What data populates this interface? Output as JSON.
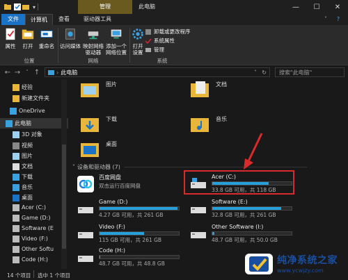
{
  "titlebar": {
    "context_tab": "管理",
    "window_title": "此电脑",
    "controls": [
      "minimize-icon",
      "maximize-icon",
      "close-icon"
    ]
  },
  "tabs": [
    "文件",
    "计算机",
    "查看",
    "驱动器工具"
  ],
  "ribbon": {
    "location": {
      "label": "位置",
      "buttons": [
        "属性",
        "打开",
        "重命名"
      ]
    },
    "network": {
      "label": "网络",
      "buttons": [
        "访问媒体",
        "映射网络\n驱动器",
        "添加一个\n网络位置"
      ]
    },
    "system": {
      "label": "系统",
      "big_button": "打开\n设置",
      "small": [
        "卸载或更改程序",
        "系统属性",
        "管理"
      ]
    }
  },
  "address": {
    "path": "此电脑",
    "search_placeholder": "搜索\"此电脑\""
  },
  "nav": {
    "items": [
      {
        "label": "经验",
        "icon": "folder-icon"
      },
      {
        "label": "新建文件夹",
        "icon": "folder-icon"
      },
      {
        "label": "OneDrive",
        "icon": "cloud-icon"
      },
      {
        "label": "此电脑",
        "icon": "computer-icon"
      },
      {
        "label": "3D 对象",
        "icon": "cube-icon"
      },
      {
        "label": "视频",
        "icon": "video-icon"
      },
      {
        "label": "图片",
        "icon": "picture-icon"
      },
      {
        "label": "文档",
        "icon": "document-icon"
      },
      {
        "label": "下载",
        "icon": "download-icon"
      },
      {
        "label": "音乐",
        "icon": "music-icon"
      },
      {
        "label": "桌面",
        "icon": "desktop-icon"
      },
      {
        "label": "Acer (C:)",
        "icon": "drive-icon"
      },
      {
        "label": "Game (D:)",
        "icon": "drive-icon"
      },
      {
        "label": "Software (E",
        "icon": "drive-icon"
      },
      {
        "label": "Video (F:)",
        "icon": "drive-icon"
      },
      {
        "label": "Other Softu",
        "icon": "drive-icon"
      },
      {
        "label": "Code (H:)",
        "icon": "drive-icon"
      }
    ]
  },
  "folders": [
    {
      "name": "图片",
      "icon": "pictures-folder-icon"
    },
    {
      "name": "文档",
      "icon": "documents-folder-icon"
    },
    {
      "name": "下载",
      "icon": "downloads-folder-icon"
    },
    {
      "name": "音乐",
      "icon": "music-folder-icon"
    },
    {
      "name": "桌面",
      "icon": "desktop-folder-icon"
    }
  ],
  "devices_header": "设备和驱动器 (7)",
  "baidu": {
    "name": "百度网盘",
    "sub": "双击运行百度网盘"
  },
  "drives": [
    {
      "name": "Acer (C:)",
      "sub": "33.8 GB 可用，共 118 GB",
      "used": 0.71
    },
    {
      "name": "Game (D:)",
      "sub": "4.27 GB 可用，共 261 GB",
      "used": 0.98
    },
    {
      "name": "Software (E:)",
      "sub": "32.8 GB 可用，共 261 GB",
      "used": 0.87
    },
    {
      "name": "Video (F:)",
      "sub": "115 GB 可用，共 261 GB",
      "used": 0.56
    },
    {
      "name": "Other Software (I:)",
      "sub": "48.7 GB 可用，共 50.0 GB",
      "used": 0.03
    },
    {
      "name": "Code (H:)",
      "sub": "48.7 GB 可用，共 48.8 GB",
      "used": 0.01
    }
  ],
  "status": {
    "count": "14 个项目",
    "selected": "选中 1 个项目"
  },
  "watermark": {
    "title": "纯净系统之家",
    "url": "www.ycwjzy.com"
  },
  "colors": {
    "accent": "#26a0da",
    "highlight": "#d92b2b",
    "context_tab": "#6b5a1f",
    "file_tab": "#1a73c7"
  }
}
